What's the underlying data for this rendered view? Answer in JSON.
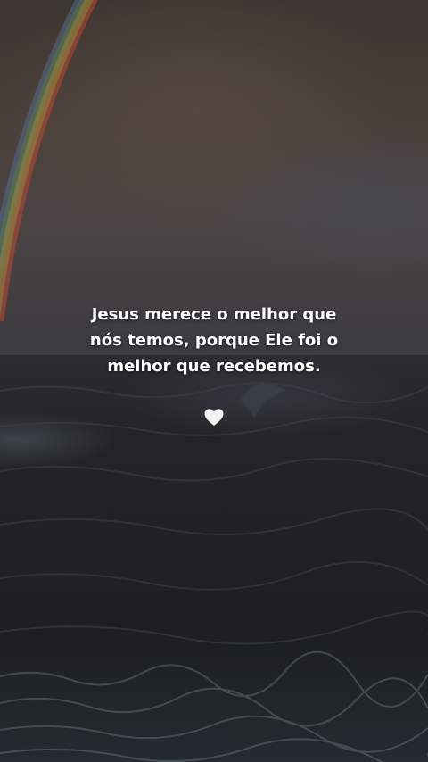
{
  "quote": {
    "line1": "Jesus merece o melhor que",
    "line2": "nós temos, porque Ele foi o",
    "line3": "melhor que recebemos."
  },
  "icons": {
    "heart": "white-heart-icon"
  },
  "colors": {
    "text": "#ffffff",
    "heart": "#f2f2f2",
    "sky": "#4a3f3a",
    "sea": "#1f2226"
  }
}
